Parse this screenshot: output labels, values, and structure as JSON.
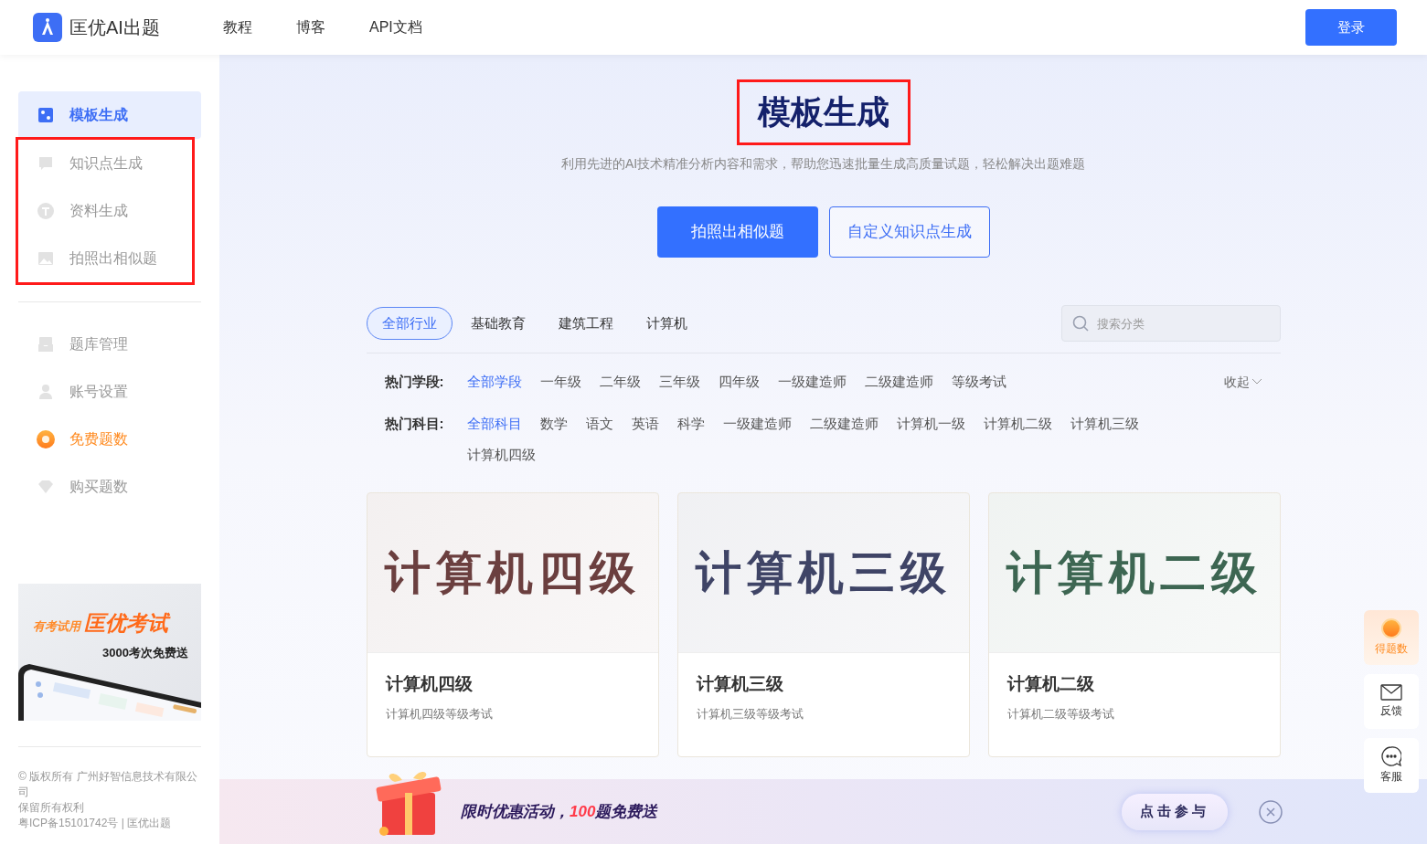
{
  "header": {
    "brand": "匡优AI出题",
    "nav": [
      {
        "label": "教程"
      },
      {
        "label": "博客"
      },
      {
        "label": "API文档"
      }
    ],
    "login": "登录"
  },
  "sidebar": {
    "groups": [
      {
        "highlighted": false,
        "items": [
          {
            "label": "模板生成",
            "kind": "nav",
            "selected": true
          }
        ]
      },
      {
        "highlighted": true,
        "items": [
          {
            "label": "知识点生成",
            "kind": "nav",
            "selected": false
          },
          {
            "label": "资料生成",
            "kind": "nav",
            "selected": false
          },
          {
            "label": "拍照出相似题",
            "kind": "nav",
            "selected": false
          }
        ]
      },
      {
        "highlighted": false,
        "divider": true,
        "items": [
          {
            "label": "题库管理",
            "kind": "nav",
            "selected": false
          },
          {
            "label": "账号设置",
            "kind": "nav",
            "selected": false
          },
          {
            "label": "免费题数",
            "kind": "promo",
            "selected": false
          },
          {
            "label": "购买题数",
            "kind": "nav",
            "selected": false
          }
        ]
      }
    ],
    "promo": {
      "tagline": "有考试用",
      "brand": "匡优考试",
      "offer": "3000考次免费送"
    },
    "footer": [
      "© 版权所有 广州好智信息技术有限公司",
      "保留所有权利",
      "粤ICP备15101742号 | 匡优出题"
    ]
  },
  "hero": {
    "title": "模板生成",
    "title_highlighted": true,
    "subtitle": "利用先进的AI技术精准分析内容和需求，帮助您迅速批量生成高质量试题，轻松解决出题难题",
    "buttons": [
      {
        "label": "拍照出相似题",
        "kind": "primary"
      },
      {
        "label": "自定义知识点生成",
        "kind": "outline"
      }
    ]
  },
  "industry_tabs": [
    {
      "label": "全部行业",
      "selected": true
    },
    {
      "label": "基础教育",
      "selected": false
    },
    {
      "label": "建筑工程",
      "selected": false
    },
    {
      "label": "计算机",
      "selected": false
    }
  ],
  "search": {
    "placeholder": "搜索分类"
  },
  "filters": [
    {
      "label": "热门学段:",
      "options": [
        {
          "label": "全部学段",
          "selected": true
        },
        {
          "label": "一年级",
          "selected": false
        },
        {
          "label": "二年级",
          "selected": false
        },
        {
          "label": "三年级",
          "selected": false
        },
        {
          "label": "四年级",
          "selected": false
        },
        {
          "label": "一级建造师",
          "selected": false
        },
        {
          "label": "二级建造师",
          "selected": false
        },
        {
          "label": "等级考试",
          "selected": false
        }
      ],
      "toggle": "收起"
    },
    {
      "label": "热门科目:",
      "options": [
        {
          "label": "全部科目",
          "selected": true
        },
        {
          "label": "数学",
          "selected": false
        },
        {
          "label": "语文",
          "selected": false
        },
        {
          "label": "英语",
          "selected": false
        },
        {
          "label": "科学",
          "selected": false
        },
        {
          "label": "一级建造师",
          "selected": false
        },
        {
          "label": "二级建造师",
          "selected": false
        },
        {
          "label": "计算机一级",
          "selected": false
        },
        {
          "label": "计算机二级",
          "selected": false
        },
        {
          "label": "计算机三级",
          "selected": false
        },
        {
          "label": "计算机四级",
          "selected": false
        }
      ]
    }
  ],
  "cards": [
    {
      "cover_text": "计算机四级",
      "color": "#6b3f3f",
      "title": "计算机四级",
      "description": "计算机四级等级考试"
    },
    {
      "cover_text": "计算机三级",
      "color": "#3f4466",
      "title": "计算机三级",
      "description": "计算机三级等级考试"
    },
    {
      "cover_text": "计算机二级",
      "color": "#3d6652",
      "title": "计算机二级",
      "description": "计算机二级等级考试"
    }
  ],
  "float_buttons": [
    {
      "label": "得题数",
      "kind": "promo"
    },
    {
      "label": "反馈",
      "kind": "mail"
    },
    {
      "label": "客服",
      "kind": "chat"
    }
  ],
  "banner": {
    "text_before": "限时优惠活动，",
    "highlight": "100",
    "text_after": "题免费送",
    "button": "点击参与"
  }
}
